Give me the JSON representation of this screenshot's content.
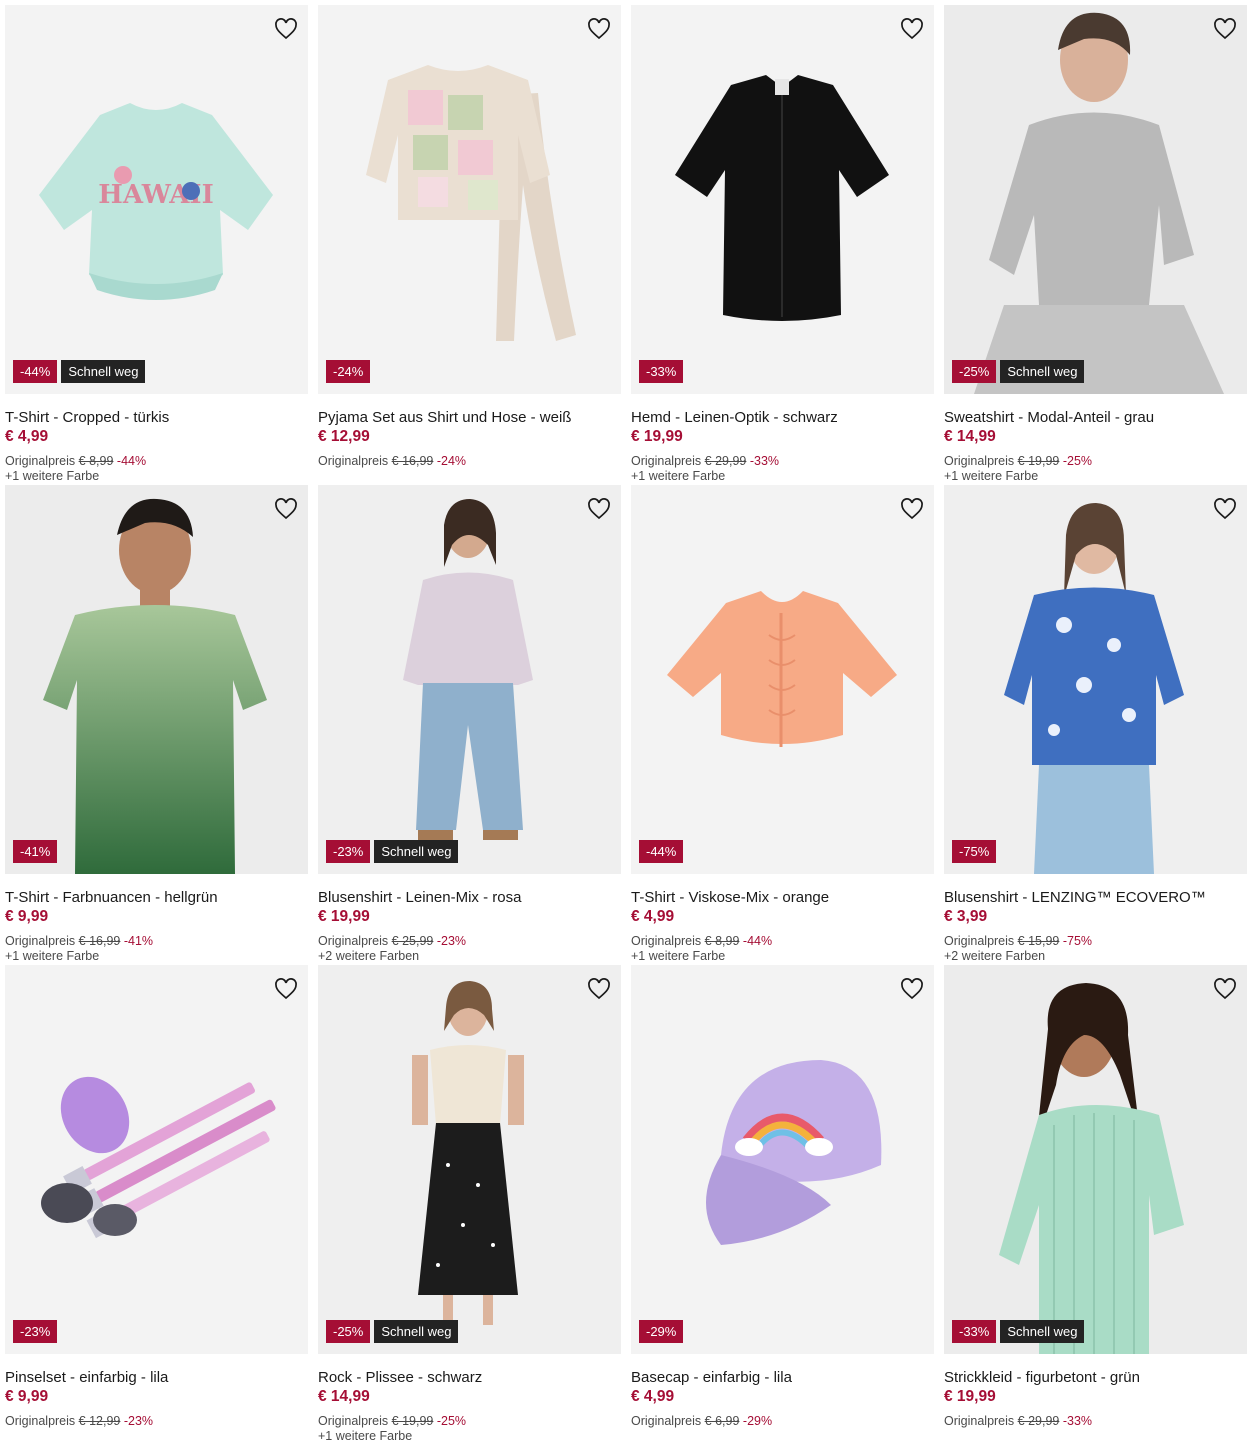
{
  "labels": {
    "original_price": "Originalpreis"
  },
  "colors": {
    "accent": "#a50e35",
    "fast_badge": "#232323",
    "image_bg": "#f1f1f1"
  },
  "products": [
    {
      "name": "T-Shirt - Cropped - türkis",
      "price": "€ 4,99",
      "original": "€ 8,99",
      "discount": "-44%",
      "fast": "Schnell weg",
      "more_colors": "+1 weitere Farbe",
      "icon": "wishlist-heart-icon"
    },
    {
      "name": "Pyjama Set aus Shirt und Hose - weiß",
      "price": "€ 12,99",
      "original": "€ 16,99",
      "discount": "-24%",
      "fast": null,
      "more_colors": null,
      "icon": "wishlist-heart-icon"
    },
    {
      "name": "Hemd - Leinen-Optik - schwarz",
      "price": "€ 19,99",
      "original": "€ 29,99",
      "discount": "-33%",
      "fast": null,
      "more_colors": "+1 weitere Farbe",
      "icon": "wishlist-heart-icon"
    },
    {
      "name": "Sweatshirt - Modal-Anteil - grau",
      "price": "€ 14,99",
      "original": "€ 19,99",
      "discount": "-25%",
      "fast": "Schnell weg",
      "more_colors": "+1 weitere Farbe",
      "icon": "wishlist-heart-icon"
    },
    {
      "name": "T-Shirt - Farbnuancen - hellgrün",
      "price": "€ 9,99",
      "original": "€ 16,99",
      "discount": "-41%",
      "fast": null,
      "more_colors": "+1 weitere Farbe",
      "icon": "wishlist-heart-icon"
    },
    {
      "name": "Blusenshirt - Leinen-Mix - rosa",
      "price": "€ 19,99",
      "original": "€ 25,99",
      "discount": "-23%",
      "fast": "Schnell weg",
      "more_colors": "+2 weitere Farben",
      "icon": "wishlist-heart-icon"
    },
    {
      "name": "T-Shirt - Viskose-Mix - orange",
      "price": "€ 4,99",
      "original": "€ 8,99",
      "discount": "-44%",
      "fast": null,
      "more_colors": "+1 weitere Farbe",
      "icon": "wishlist-heart-icon"
    },
    {
      "name": "Blusenshirt - LENZING™ ECOVERO™",
      "price": "€ 3,99",
      "original": "€ 15,99",
      "discount": "-75%",
      "fast": null,
      "more_colors": "+2 weitere Farben",
      "icon": "wishlist-heart-icon"
    },
    {
      "name": "Pinselset - einfarbig - lila",
      "price": "€ 9,99",
      "original": "€ 12,99",
      "discount": "-23%",
      "fast": null,
      "more_colors": null,
      "icon": "wishlist-heart-icon"
    },
    {
      "name": "Rock - Plissee - schwarz",
      "price": "€ 14,99",
      "original": "€ 19,99",
      "discount": "-25%",
      "fast": "Schnell weg",
      "more_colors": "+1 weitere Farbe",
      "icon": "wishlist-heart-icon"
    },
    {
      "name": "Basecap - einfarbig - lila",
      "price": "€ 4,99",
      "original": "€ 6,99",
      "discount": "-29%",
      "fast": null,
      "more_colors": null,
      "icon": "wishlist-heart-icon"
    },
    {
      "name": "Strickkleid - figurbetont - grün",
      "price": "€ 19,99",
      "original": "€ 29,99",
      "discount": "-33%",
      "fast": "Schnell weg",
      "more_colors": null,
      "icon": "wishlist-heart-icon"
    }
  ]
}
